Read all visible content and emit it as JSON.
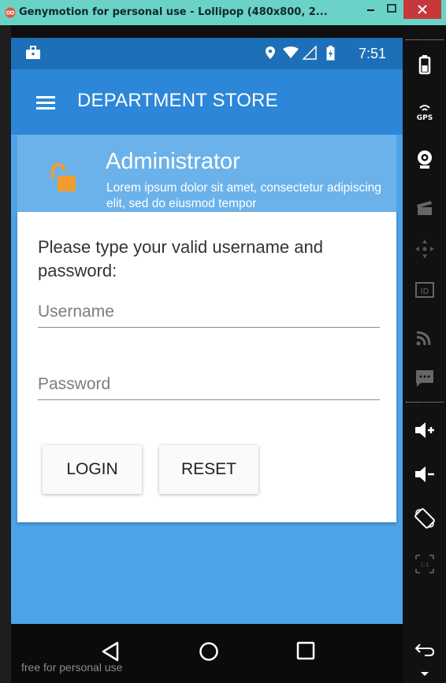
{
  "window": {
    "title": "Genymotion for personal use - Lollipop (480x800, 2...",
    "minimize_label": "–",
    "maximize_label": "□",
    "close_label": "×"
  },
  "statusbar": {
    "time": "7:51"
  },
  "appbar": {
    "title": "DEPARTMENT STORE"
  },
  "header": {
    "title": "Administrator",
    "description": "Lorem ipsum dolor sit amet, consectetur adipiscing elit, sed do eiusmod tempor"
  },
  "form": {
    "prompt": "Please type your valid username and password:",
    "username_placeholder": "Username",
    "username_value": "",
    "password_placeholder": "Password",
    "password_value": "",
    "login_label": "LOGIN",
    "reset_label": "RESET"
  },
  "navbar": {
    "watermark": "free for personal use"
  },
  "colors": {
    "title_bar": "#6bd2c8",
    "status_bar": "#1d6fb7",
    "app_bar": "#2c87d9",
    "content_bg": "#4ea3e8",
    "accent_lock": "#f29b2f"
  },
  "toolbar": {
    "icons": [
      "battery-icon",
      "gps-icon",
      "webcam-icon",
      "camera-icon",
      "dpad-icon",
      "id-icon",
      "rss-icon",
      "sms-icon",
      "volume-up-icon",
      "volume-down-icon",
      "rotate-icon",
      "resize-icon",
      "back-arrow-icon"
    ],
    "gps_label": "GPS",
    "id_label": "ID"
  }
}
